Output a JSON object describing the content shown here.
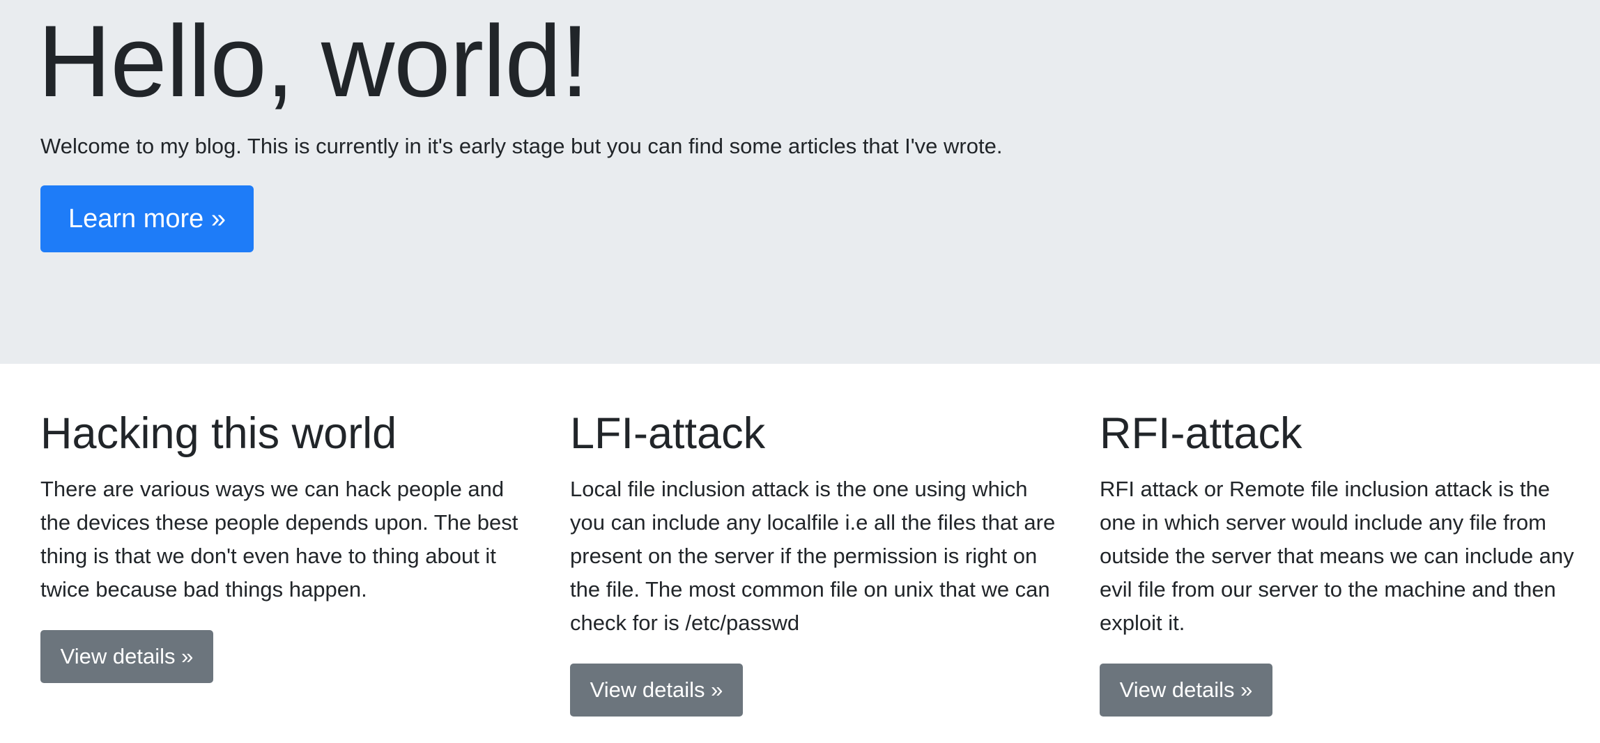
{
  "hero": {
    "title": "Hello, world!",
    "lead": "Welcome to my blog. This is currently in it's early stage but you can find some articles that I've wrote.",
    "button_label": "Learn more »"
  },
  "articles": [
    {
      "title": "Hacking this world",
      "body": "There are various ways we can hack people and the devices these people depends upon. The best thing is that we don't even have to thing about it twice because bad things happen.",
      "button_label": "View details »"
    },
    {
      "title": "LFI-attack",
      "body": "Local file inclusion attack is the one using which you can include any localfile i.e all the files that are present on the server if the permission is right on the file. The most common file on unix that we can check for is /etc/passwd",
      "button_label": "View details »"
    },
    {
      "title": "RFI-attack",
      "body": "RFI attack or Remote file inclusion attack is the one in which server would include any file from outside the server that means we can include any evil file from our server to the machine and then exploit it.",
      "button_label": "View details »"
    }
  ],
  "colors": {
    "jumbotron_bg": "#e9ecef",
    "primary": "#1e7cf8",
    "secondary": "#6c757d",
    "text": "#212529"
  }
}
